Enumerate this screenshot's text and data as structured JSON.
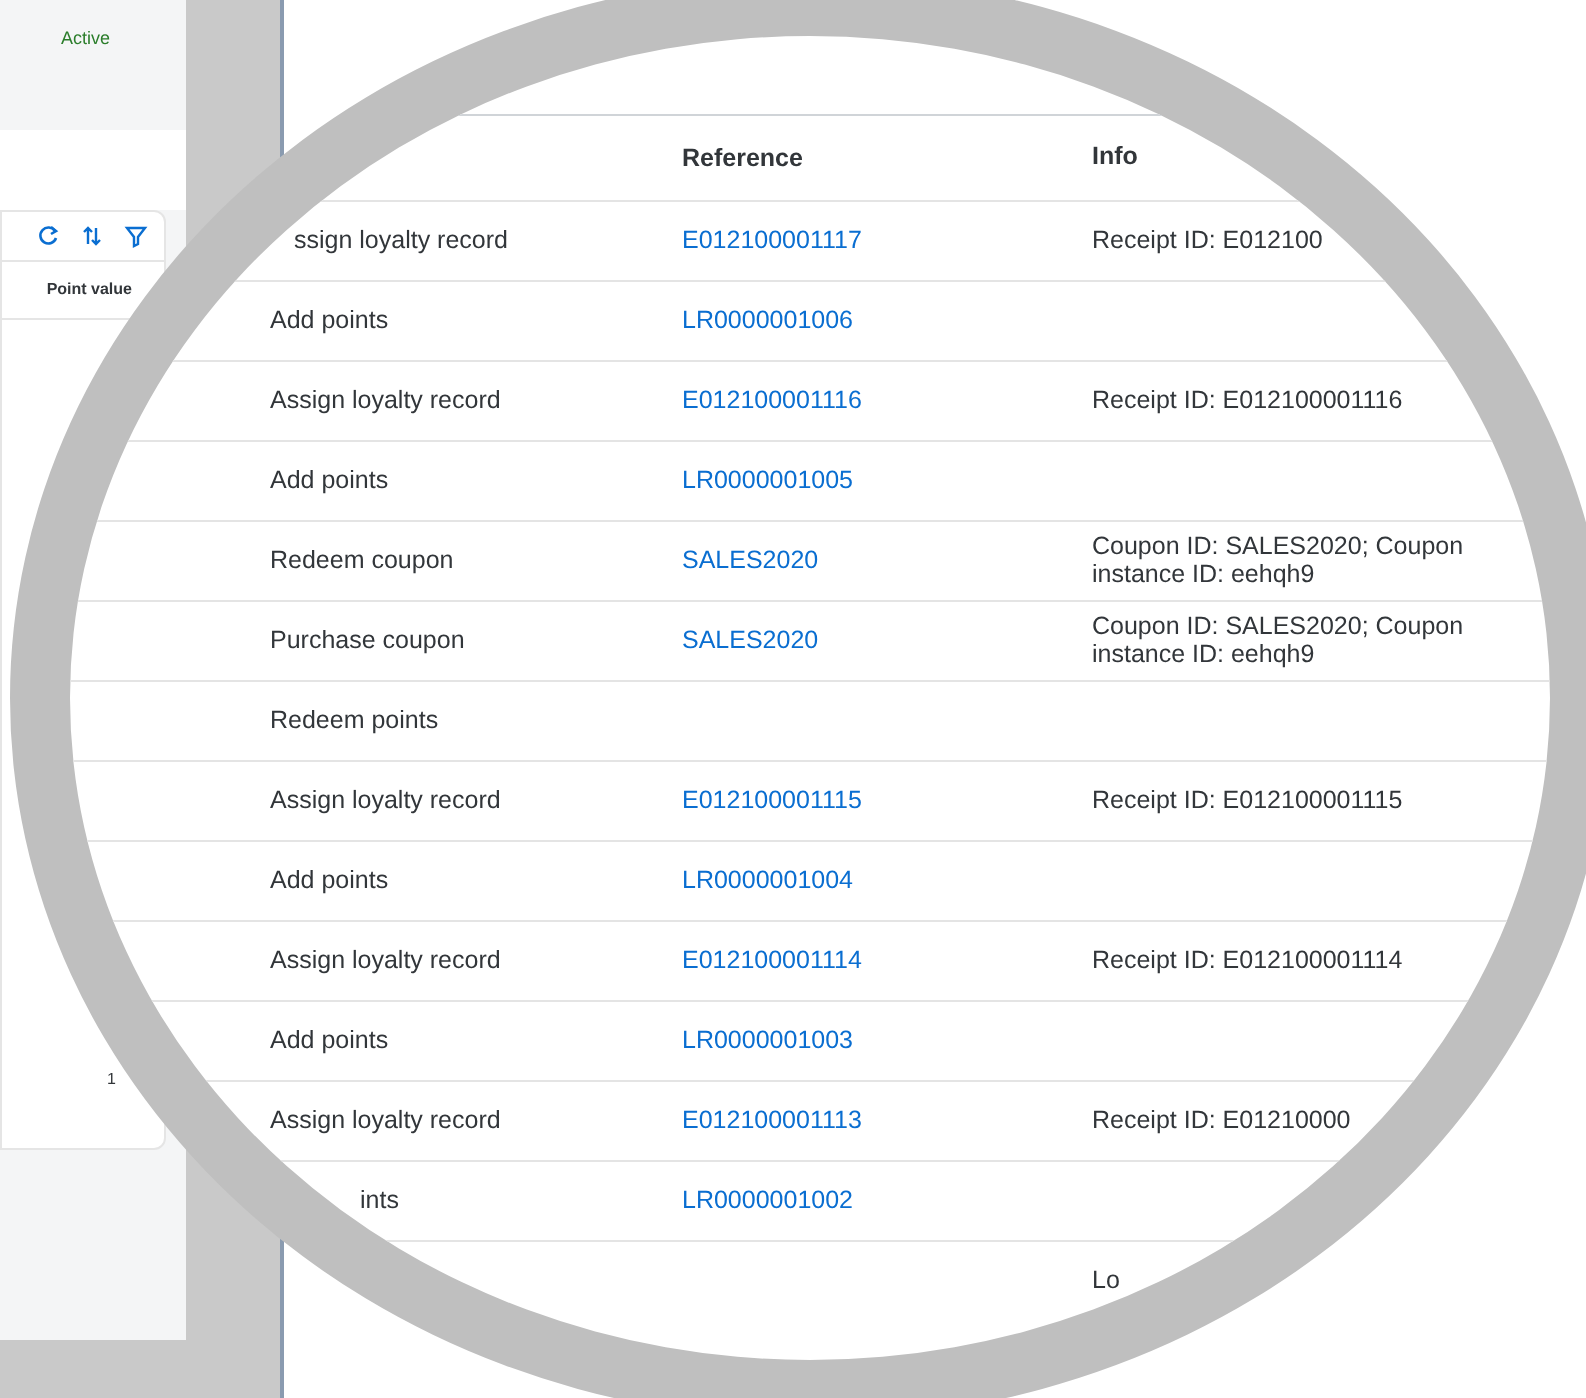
{
  "background_panel": {
    "status": "Active",
    "column_header": "Point value",
    "cell": "1"
  },
  "magnified_table": {
    "columns": [
      "",
      "Reference",
      "Info"
    ],
    "rows": [
      {
        "type": "ssign loyalty record",
        "reference": "E012100001117",
        "info": "Receipt ID: E012100"
      },
      {
        "type": "Add points",
        "reference": "LR0000001006"
      },
      {
        "type": "Assign loyalty record",
        "reference": "E012100001116",
        "info": "Receipt ID: E012100001116"
      },
      {
        "type": "Add points",
        "reference": "LR0000001005"
      },
      {
        "type": "Redeem coupon",
        "reference": "SALES2020",
        "info": "Coupon ID: SALES2020; Coupon instance ID: eehqh9"
      },
      {
        "type": "Purchase coupon",
        "reference": "SALES2020",
        "info": "Coupon ID: SALES2020; Coupon instance ID: eehqh9"
      },
      {
        "type": "Redeem points"
      },
      {
        "type": "Assign loyalty record",
        "reference": "E012100001115",
        "info": "Receipt ID: E012100001115"
      },
      {
        "type": "Add points",
        "reference": "LR0000001004"
      },
      {
        "type": "Assign loyalty record",
        "reference": "E012100001114",
        "info": "Receipt ID: E012100001114"
      },
      {
        "type": "Add points",
        "reference": "LR0000001003"
      },
      {
        "type": "Assign loyalty record",
        "reference": "E012100001113",
        "info": "Receipt ID: E01210000"
      },
      {
        "type": "ints",
        "reference": "LR0000001002"
      },
      {
        "info": "Lo"
      }
    ]
  }
}
